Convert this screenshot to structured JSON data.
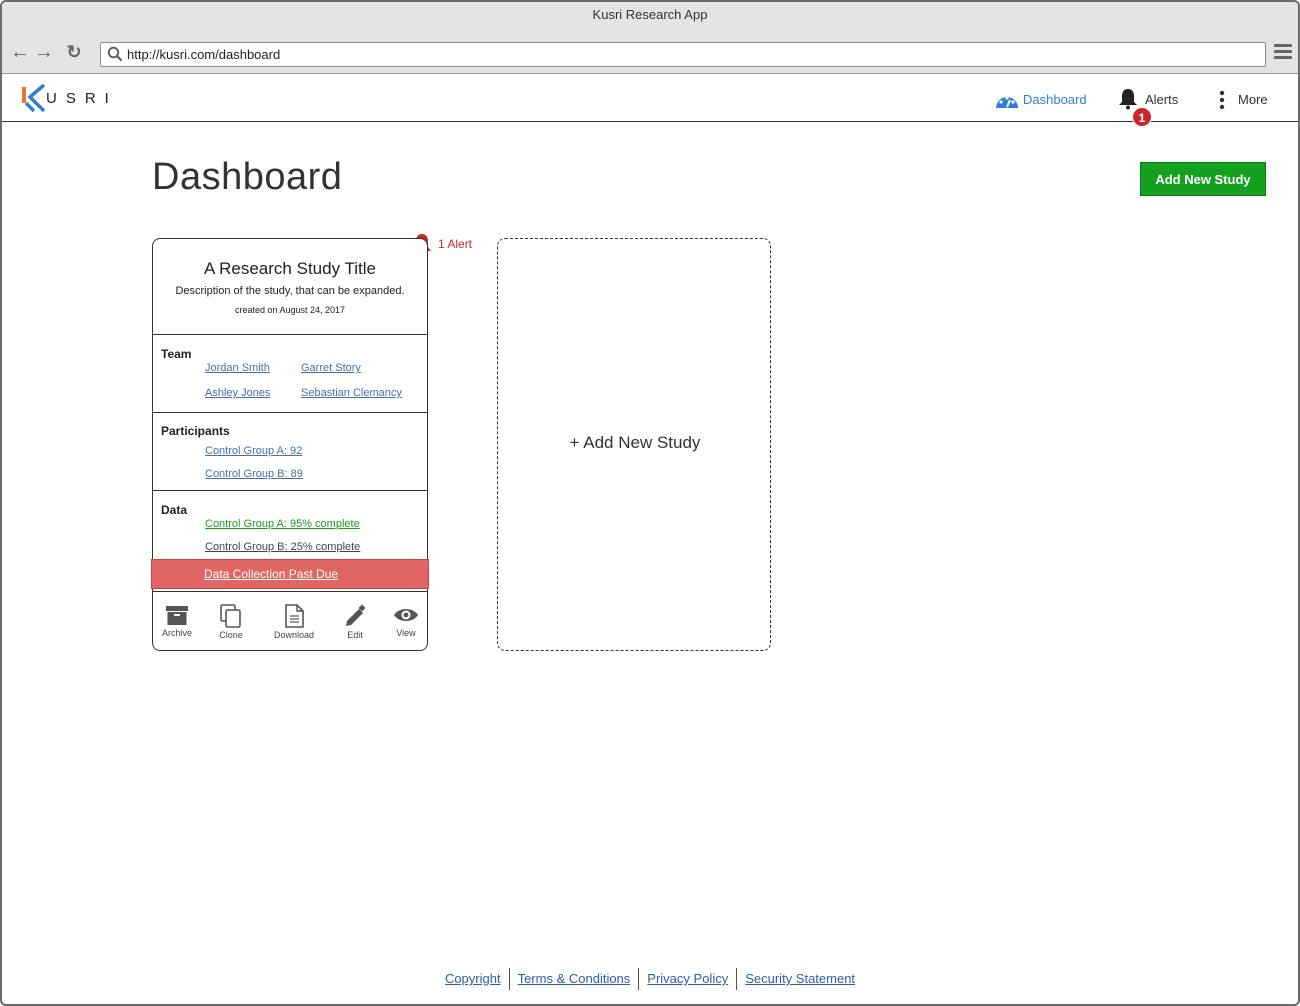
{
  "browser": {
    "window_title": "Kusri Research App",
    "url": "http://kusri.com/dashboard"
  },
  "header": {
    "logo_text": "USRI",
    "nav": {
      "dashboard": "Dashboard",
      "alerts": "Alerts",
      "alerts_badge": "1",
      "more": "More"
    },
    "accent_color": "#2f7fd8"
  },
  "page": {
    "title": "Dashboard",
    "add_button": "Add New Study"
  },
  "study_card": {
    "alert_label": "1 Alert",
    "title": "A Research Study Title",
    "description": "Description of the study, that can be expanded.",
    "created": "created on August 24, 2017",
    "team": {
      "label": "Team",
      "members": [
        "Jordan Smith",
        "Garret Story",
        "Ashley Jones",
        "Sebastian Clemancy"
      ]
    },
    "participants": {
      "label": "Participants",
      "groups": [
        "Control Group A: 92",
        "Control Group B: 89"
      ]
    },
    "data": {
      "label": "Data",
      "items": [
        "Control Group A: 95% complete",
        "Control Group B: 25% complete"
      ],
      "past_due": "Data Collection Past Due"
    },
    "actions": [
      "Archive",
      "Clone",
      "Download",
      "Edit",
      "View"
    ]
  },
  "new_study_card": {
    "label": "+ Add New Study"
  },
  "footer": {
    "links": [
      "Copyright",
      "Terms & Conditions",
      "Privacy Policy",
      "Security Statement"
    ]
  },
  "colors": {
    "success": "#15a020",
    "danger": "#e06666",
    "alert": "#d0262b"
  }
}
